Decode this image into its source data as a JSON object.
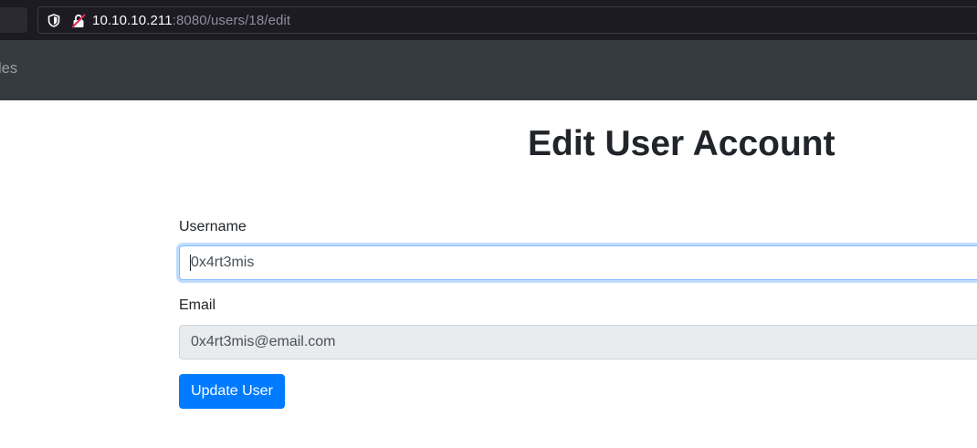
{
  "browser": {
    "url_host": "10.10.10.211",
    "url_rest": ":8080/users/18/edit",
    "icons": {
      "tracking_protection": "shield-icon",
      "security": "insecure-lock-icon"
    }
  },
  "navbar": {
    "partial_link": "les"
  },
  "page": {
    "title": "Edit User Account"
  },
  "form": {
    "username_label": "Username",
    "username_value": "0x4rt3mis",
    "email_label": "Email",
    "email_value": "0x4rt3mis@email.com",
    "submit_label": "Update User"
  },
  "colors": {
    "navbar": "#343a40",
    "primary": "#007bff",
    "readonly_bg": "#e9ecef"
  }
}
